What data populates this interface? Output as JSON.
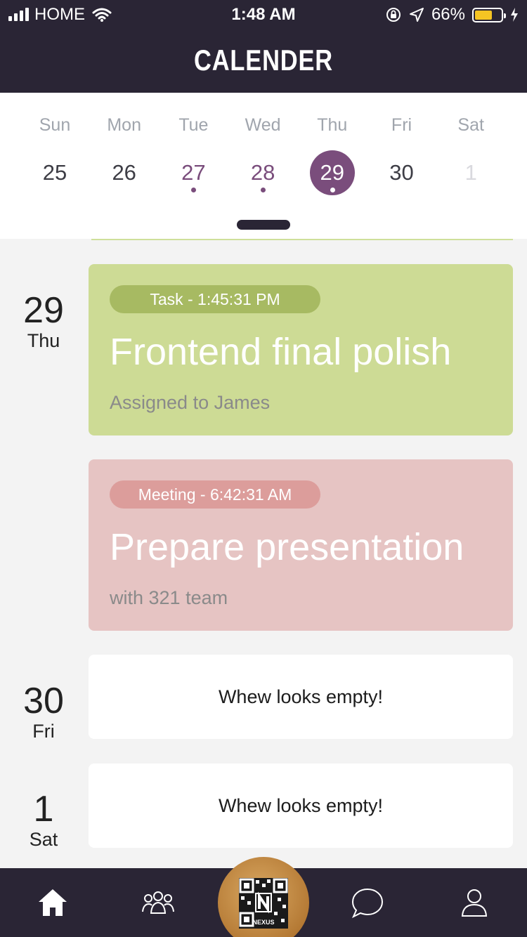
{
  "status_bar": {
    "carrier": "HOME",
    "time": "1:48 AM",
    "battery_pct": "66%",
    "battery_level": 0.66,
    "battery_color": "#f5c423"
  },
  "header": {
    "title": "CALENDER"
  },
  "week": {
    "days": [
      {
        "dow": "Sun",
        "num": "25",
        "has_event": false,
        "selected": false,
        "faded": false
      },
      {
        "dow": "Mon",
        "num": "26",
        "has_event": false,
        "selected": false,
        "faded": false
      },
      {
        "dow": "Tue",
        "num": "27",
        "has_event": true,
        "selected": false,
        "faded": false
      },
      {
        "dow": "Wed",
        "num": "28",
        "has_event": true,
        "selected": false,
        "faded": false
      },
      {
        "dow": "Thu",
        "num": "29",
        "has_event": true,
        "selected": true,
        "faded": false
      },
      {
        "dow": "Fri",
        "num": "30",
        "has_event": false,
        "selected": false,
        "faded": false
      },
      {
        "dow": "Sat",
        "num": "1",
        "has_event": false,
        "selected": false,
        "faded": true
      }
    ]
  },
  "agenda": {
    "day29": {
      "num": "29",
      "dow": "Thu"
    },
    "day30": {
      "num": "30",
      "dow": "Fri"
    },
    "day1": {
      "num": "1",
      "dow": "Sat"
    },
    "events": [
      {
        "tag": "Task - 1:45:31 PM",
        "title": "Frontend final polish",
        "subtitle": "Assigned to James",
        "color": "#cddb95"
      },
      {
        "tag": "Meeting - 6:42:31 AM",
        "title": "Prepare presentation",
        "subtitle": "with 321 team",
        "color": "#e6c4c3"
      }
    ],
    "empty_text": "Whew looks empty!"
  },
  "tab_bar": {
    "items": [
      "home-icon",
      "team-icon",
      "qr-scan-icon",
      "chat-icon",
      "profile-icon"
    ],
    "qr_label": "NEXUS"
  },
  "colors": {
    "primary_dark": "#2a2535",
    "accent_purple": "#7a4d7c",
    "gold": "#b57a35"
  }
}
